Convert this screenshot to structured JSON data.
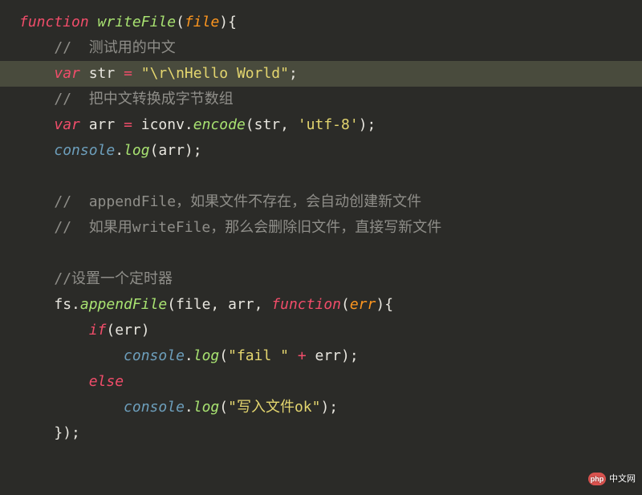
{
  "code": {
    "lines": [
      {
        "indent": 0,
        "hl": false,
        "tokens": [
          {
            "cls": "kw",
            "t": "function"
          },
          {
            "cls": "ident",
            "t": " "
          },
          {
            "cls": "fn",
            "t": "writeFile"
          },
          {
            "cls": "ident",
            "t": "("
          },
          {
            "cls": "param",
            "t": "file"
          },
          {
            "cls": "ident",
            "t": "){"
          }
        ]
      },
      {
        "indent": 1,
        "hl": false,
        "tokens": [
          {
            "cls": "cmt",
            "t": "//  测试用的中文"
          }
        ]
      },
      {
        "indent": 1,
        "hl": true,
        "tokens": [
          {
            "cls": "kw",
            "t": "var"
          },
          {
            "cls": "ident",
            "t": " str "
          },
          {
            "cls": "kw",
            "t": "="
          },
          {
            "cls": "ident",
            "t": " "
          },
          {
            "cls": "str",
            "t": "\"\\r\\nHello World\""
          },
          {
            "cls": "ident",
            "t": ";"
          }
        ]
      },
      {
        "indent": 1,
        "hl": false,
        "tokens": [
          {
            "cls": "cmt",
            "t": "//  把中文转换成字节数组"
          }
        ]
      },
      {
        "indent": 1,
        "hl": false,
        "tokens": [
          {
            "cls": "kw",
            "t": "var"
          },
          {
            "cls": "ident",
            "t": " arr "
          },
          {
            "cls": "kw",
            "t": "="
          },
          {
            "cls": "ident",
            "t": " iconv."
          },
          {
            "cls": "fn",
            "t": "encode"
          },
          {
            "cls": "ident",
            "t": "(str, "
          },
          {
            "cls": "str",
            "t": "'utf-8'"
          },
          {
            "cls": "ident",
            "t": ");"
          }
        ]
      },
      {
        "indent": 1,
        "hl": false,
        "tokens": [
          {
            "cls": "obj",
            "t": "console"
          },
          {
            "cls": "ident",
            "t": "."
          },
          {
            "cls": "fn",
            "t": "log"
          },
          {
            "cls": "ident",
            "t": "(arr);"
          }
        ]
      },
      {
        "indent": 1,
        "hl": false,
        "tokens": [
          {
            "cls": "ident",
            "t": " "
          }
        ]
      },
      {
        "indent": 1,
        "hl": false,
        "tokens": [
          {
            "cls": "cmt",
            "t": "//  appendFile，如果文件不存在，会自动创建新文件"
          }
        ]
      },
      {
        "indent": 1,
        "hl": false,
        "tokens": [
          {
            "cls": "cmt",
            "t": "//  如果用writeFile，那么会删除旧文件，直接写新文件"
          }
        ]
      },
      {
        "indent": 1,
        "hl": false,
        "tokens": [
          {
            "cls": "ident",
            "t": " "
          }
        ]
      },
      {
        "indent": 1,
        "hl": false,
        "tokens": [
          {
            "cls": "cmt",
            "t": "//设置一个定时器"
          }
        ]
      },
      {
        "indent": 1,
        "hl": false,
        "tokens": [
          {
            "cls": "ident",
            "t": "fs."
          },
          {
            "cls": "fn",
            "t": "appendFile"
          },
          {
            "cls": "ident",
            "t": "(file, arr, "
          },
          {
            "cls": "kw",
            "t": "function"
          },
          {
            "cls": "ident",
            "t": "("
          },
          {
            "cls": "param",
            "t": "err"
          },
          {
            "cls": "ident",
            "t": "){"
          }
        ]
      },
      {
        "indent": 2,
        "hl": false,
        "tokens": [
          {
            "cls": "kw",
            "t": "if"
          },
          {
            "cls": "ident",
            "t": "(err)"
          }
        ]
      },
      {
        "indent": 3,
        "hl": false,
        "tokens": [
          {
            "cls": "obj",
            "t": "console"
          },
          {
            "cls": "ident",
            "t": "."
          },
          {
            "cls": "fn",
            "t": "log"
          },
          {
            "cls": "ident",
            "t": "("
          },
          {
            "cls": "str",
            "t": "\"fail \""
          },
          {
            "cls": "ident",
            "t": " "
          },
          {
            "cls": "kw",
            "t": "+"
          },
          {
            "cls": "ident",
            "t": " err);"
          }
        ]
      },
      {
        "indent": 2,
        "hl": false,
        "tokens": [
          {
            "cls": "kw",
            "t": "else"
          }
        ]
      },
      {
        "indent": 3,
        "hl": false,
        "tokens": [
          {
            "cls": "obj",
            "t": "console"
          },
          {
            "cls": "ident",
            "t": "."
          },
          {
            "cls": "fn",
            "t": "log"
          },
          {
            "cls": "ident",
            "t": "("
          },
          {
            "cls": "str",
            "t": "\"写入文件ok\""
          },
          {
            "cls": "ident",
            "t": ");"
          }
        ]
      },
      {
        "indent": 1,
        "hl": false,
        "tokens": [
          {
            "cls": "ident",
            "t": "});"
          }
        ]
      }
    ]
  },
  "badge": {
    "text": "中文网",
    "logo_text": "php"
  },
  "indent_unit": "    "
}
